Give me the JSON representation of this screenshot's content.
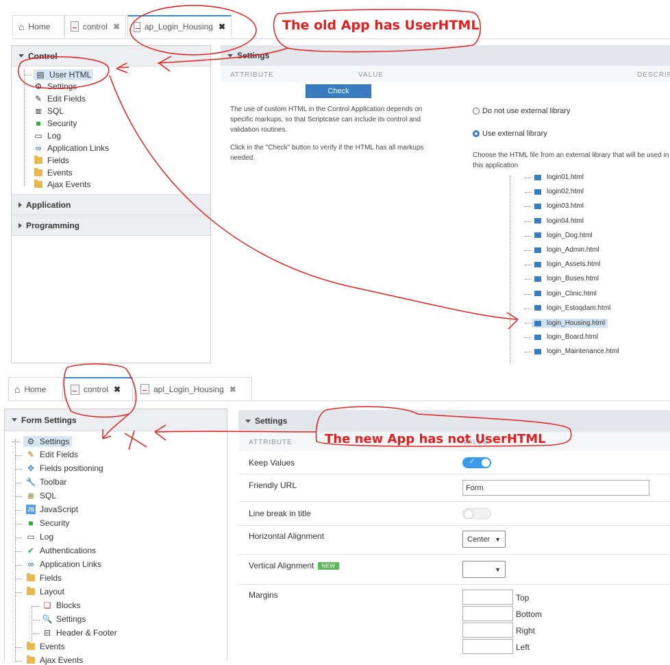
{
  "top": {
    "tabs": [
      {
        "label": "Home",
        "icon": "home-icon"
      },
      {
        "label": "control",
        "icon": "document-icon"
      },
      {
        "label": "ap_Login_Housing",
        "icon": "document-icon"
      }
    ],
    "left_panel": {
      "title": "Control",
      "items": [
        "User HTML",
        "Settings",
        "Edit Fields",
        "SQL",
        "Security",
        "Log",
        "Application Links",
        "Fields",
        "Events",
        "Ajax Events"
      ],
      "sections": [
        "Application",
        "Programming"
      ]
    },
    "settings": {
      "title": "Settings",
      "col_attribute": "ATTRIBUTE",
      "col_value": "VALUE",
      "col_description": "DESCRIPT",
      "check_label": "Check",
      "desc1": "The use of custom HTML in the Control Application depends on specific markups, so that Scriptcase can include its control and validation routines.",
      "desc2": "Click in the \"Check\" button to verify if the HTML has all markups needed.",
      "radio1": "Do not use external library",
      "radio2": "Use external library",
      "choose_text": "Choose the HTML file from an external library that will be used in this application",
      "files": [
        "login01.html",
        "login02.html",
        "login03.html",
        "login04.html",
        "login_Dog.html",
        "login_Admin.html",
        "login_Assets.html",
        "login_Buses.html",
        "login_Clinic.html",
        "login_Estoqdam.html",
        "login_Housing.html",
        "login_Board.html",
        "login_Maintenance.html"
      ]
    },
    "annotation": "The old App has UserHTML"
  },
  "bottom": {
    "tabs": [
      {
        "label": "Home",
        "icon": "home-icon"
      },
      {
        "label": "control",
        "icon": "document-icon"
      },
      {
        "label": "apl_Login_Housing",
        "icon": "document-icon"
      }
    ],
    "left_panel": {
      "title": "Form Settings",
      "items": [
        "Settings",
        "Edit Fields",
        "Fields positioning",
        "Toolbar",
        "SQL",
        "JavaScript",
        "Security",
        "Log",
        "Authentications",
        "Application Links",
        "Fields",
        "Layout",
        "Blocks",
        "Settings",
        "Header & Footer",
        "Events",
        "Ajax Events"
      ]
    },
    "settings": {
      "title": "Settings",
      "col_attribute": "ATTRIBUTE",
      "col_value": "VALUE",
      "rows": {
        "keep_values": "Keep Values",
        "friendly_url": "Friendly URL",
        "friendly_url_value": "Form",
        "line_break": "Line break in title",
        "h_align": "Horizontal Alignment",
        "h_align_value": "Center",
        "v_align": "Vertical Alignment",
        "v_align_badge": "NEW",
        "v_align_value": "",
        "margins": "Margins",
        "margin_top": "Top",
        "margin_bottom": "Bottom",
        "margin_right": "Right",
        "margin_left": "Left"
      },
      "keep_values_check": "✓"
    },
    "annotation": "The new App has not UserHTML"
  },
  "colors": {
    "accent": "#3a7cc2",
    "annotation": "#e02020",
    "toggle_on": "#3a9bec"
  }
}
